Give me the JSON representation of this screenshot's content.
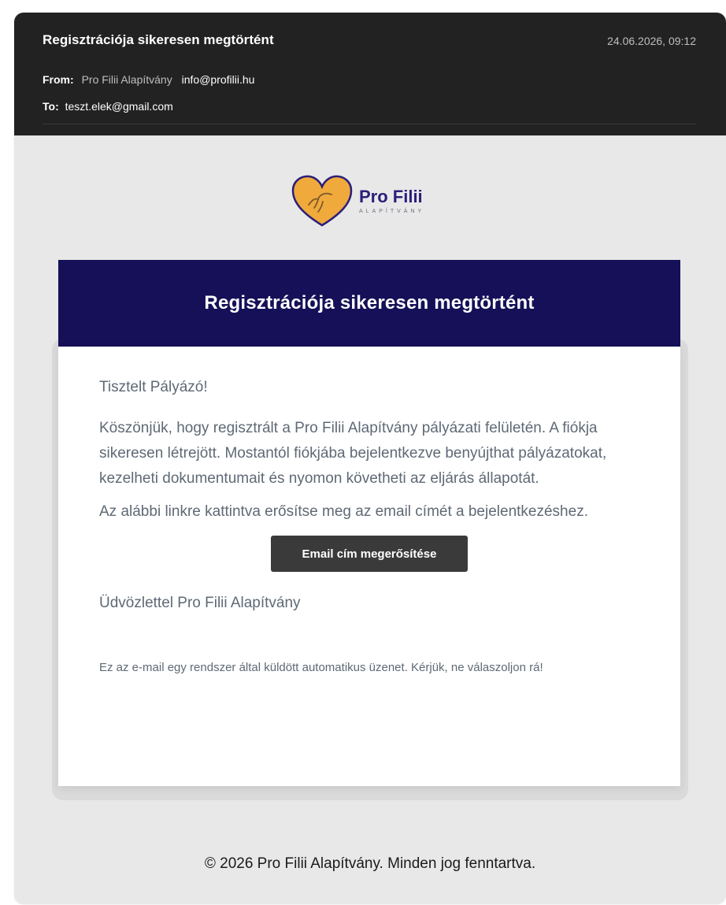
{
  "email": {
    "subject": "Regisztrációja sikeresen megtörtént",
    "datetime": "24.06.2026, 09:12",
    "from_label": "From:",
    "from_name": "Pro Filii Alapítvány",
    "from_email": "info@profilii.hu",
    "to_label": "To:",
    "to_email": "teszt.elek@gmail.com"
  },
  "logo": {
    "title": "Pro Filii",
    "subtitle": "ALAPÍTVÁNY"
  },
  "card": {
    "title": "Regisztrációja sikeresen megtörtént",
    "greeting": "Tisztelt Pályázó!",
    "paragraph1": "Köszönjük, hogy regisztrált a Pro Filii Alapítvány pályázati felületén. A fiókja sikeresen létrejött. Mostantól fiókjába bejelentkezve benyújthat pályázatokat, kezelheti dokumentumait és nyomon követheti az eljárás állapotát.",
    "paragraph2": "Az alábbi linkre kattintva erősítse meg az email címét a bejelentkezéshez.",
    "button_label": "Email cím megerősítése",
    "signoff": "Üdvözlettel Pro Filii Alapítvány",
    "note": "Ez az e-mail egy rendszer által küldött automatikus üzenet. Kérjük, ne válaszoljon rá!"
  },
  "footer": {
    "copyright": "© 2026 Pro Filii Alapítvány. Minden jog fenntartva."
  },
  "colors": {
    "header_bg": "#222222",
    "card_header_bg": "#151057",
    "button_bg": "#3a3a3a",
    "body_bg": "#e8e8e8",
    "logo_heart": "#f0a93b",
    "logo_text": "#2a1f7a"
  },
  "icons": {
    "logo": "heart-hand-icon"
  }
}
